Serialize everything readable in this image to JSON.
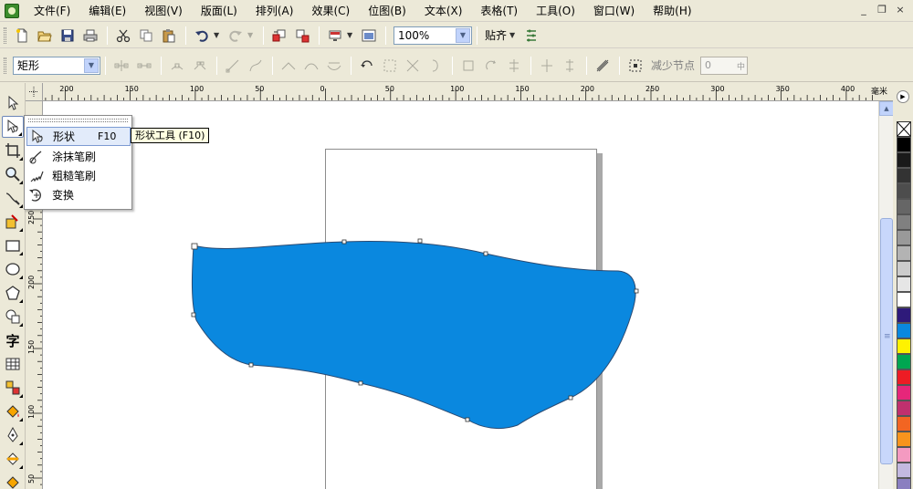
{
  "menu": {
    "items": [
      "文件(F)",
      "编辑(E)",
      "视图(V)",
      "版面(L)",
      "排列(A)",
      "效果(C)",
      "位图(B)",
      "文本(X)",
      "表格(T)",
      "工具(O)",
      "窗口(W)",
      "帮助(H)"
    ],
    "window_controls": [
      "_",
      "❐",
      "×"
    ]
  },
  "standard_toolbar": {
    "zoom_value": "100%",
    "snap_label": "贴齐"
  },
  "property_bar": {
    "object_type": "矩形",
    "reduce_nodes_label": "减少节点",
    "reduce_nodes_value": "0"
  },
  "ruler": {
    "unit": "毫米",
    "horizontal_labels": [
      "200",
      "150",
      "100",
      "50",
      "0",
      "50",
      "100",
      "150",
      "200",
      "250",
      "300",
      "350",
      "400"
    ],
    "vertical_labels": [
      "250",
      "200",
      "150",
      "100",
      "50"
    ]
  },
  "flyout": {
    "items": [
      {
        "label": "形状",
        "shortcut": "F10",
        "icon": "shape-icon"
      },
      {
        "label": "涂抹笔刷",
        "shortcut": "",
        "icon": "smudge-brush-icon"
      },
      {
        "label": "粗糙笔刷",
        "shortcut": "",
        "icon": "roughen-brush-icon"
      },
      {
        "label": "变换",
        "shortcut": "",
        "icon": "transform-icon"
      }
    ]
  },
  "tooltip": "形状工具 (F10)",
  "canvas": {
    "shape_fill": "#0a88df"
  },
  "palette": {
    "colors": [
      "#000000",
      "#1a1a1a",
      "#333333",
      "#4d4d4d",
      "#666666",
      "#808080",
      "#999999",
      "#b3b3b3",
      "#cccccc",
      "#e6e6e6",
      "#ffffff",
      "#2e1a7a",
      "#0a88df",
      "#fff200",
      "#00a651",
      "#ed1c24",
      "#e6267a",
      "#c0306e",
      "#f26522",
      "#f7941d",
      "#f49ac1",
      "#c3b9e0",
      "#8a7fc0"
    ]
  }
}
